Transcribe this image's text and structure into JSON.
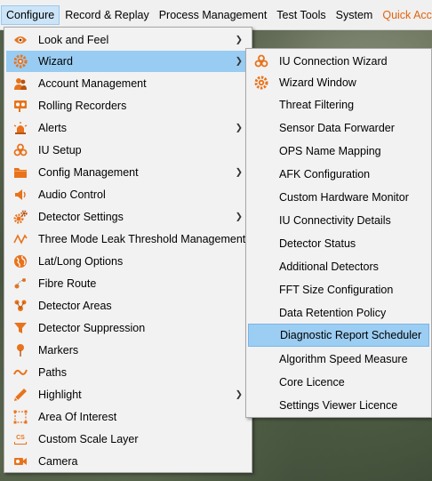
{
  "menubar": {
    "items": [
      "Configure",
      "Record & Replay",
      "Process Management",
      "Test Tools",
      "System",
      "Quick Access"
    ]
  },
  "configure_menu": {
    "items": [
      {
        "label": "Look and Feel",
        "icon": "eye-icon",
        "submenu": true
      },
      {
        "label": "Wizard",
        "icon": "gear-wizard-icon",
        "submenu": true
      },
      {
        "label": "Account Management",
        "icon": "users-icon",
        "submenu": false
      },
      {
        "label": "Rolling Recorders",
        "icon": "recorder-icon",
        "submenu": false
      },
      {
        "label": "Alerts",
        "icon": "siren-icon",
        "submenu": true
      },
      {
        "label": "IU Setup",
        "icon": "biohazard-icon",
        "submenu": false
      },
      {
        "label": "Config Management",
        "icon": "folder-icon",
        "submenu": true
      },
      {
        "label": "Audio Control",
        "icon": "speaker-icon",
        "submenu": false
      },
      {
        "label": "Detector Settings",
        "icon": "gears-icon",
        "submenu": true
      },
      {
        "label": "Three Mode Leak Threshold Management",
        "icon": "wave-icon",
        "submenu": false
      },
      {
        "label": "Lat/Long Options",
        "icon": "globe-icon",
        "submenu": false
      },
      {
        "label": "Fibre Route",
        "icon": "route-icon",
        "submenu": false
      },
      {
        "label": "Detector Areas",
        "icon": "group-icon",
        "submenu": false
      },
      {
        "label": "Detector Suppression",
        "icon": "filter-icon",
        "submenu": false
      },
      {
        "label": "Markers",
        "icon": "pin-icon",
        "submenu": false
      },
      {
        "label": "Paths",
        "icon": "path-icon",
        "submenu": false
      },
      {
        "label": "Highlight",
        "icon": "pencil-icon",
        "submenu": true
      },
      {
        "label": "Area Of Interest",
        "icon": "selection-icon",
        "submenu": false
      },
      {
        "label": "Custom Scale Layer",
        "icon": "scale-icon",
        "submenu": false
      },
      {
        "label": "Camera",
        "icon": "camera-icon",
        "submenu": false
      }
    ],
    "scale_icon_text": "CS"
  },
  "wizard_menu": {
    "items": [
      {
        "label": "IU Connection Wizard",
        "icon": "biohazard-icon"
      },
      {
        "label": "Wizard Window",
        "icon": "gear-wizard-icon"
      },
      {
        "label": "Threat Filtering",
        "icon": ""
      },
      {
        "label": "Sensor Data Forwarder",
        "icon": ""
      },
      {
        "label": "OPS Name Mapping",
        "icon": ""
      },
      {
        "label": "AFK Configuration",
        "icon": ""
      },
      {
        "label": "Custom Hardware Monitor",
        "icon": ""
      },
      {
        "label": "IU Connectivity Details",
        "icon": ""
      },
      {
        "label": "Detector Status",
        "icon": ""
      },
      {
        "label": "Additional Detectors",
        "icon": ""
      },
      {
        "label": "FFT Size Configuration",
        "icon": ""
      },
      {
        "label": "Data Retention Policy",
        "icon": ""
      },
      {
        "label": "Diagnostic Report Scheduler",
        "icon": ""
      },
      {
        "label": "Algorithm Speed Measure",
        "icon": ""
      },
      {
        "label": "Core Licence",
        "icon": ""
      },
      {
        "label": "Settings Viewer Licence",
        "icon": ""
      }
    ]
  },
  "colors": {
    "icon_orange": "#e8731c",
    "highlight": "#99ccf2",
    "quick_access": "#e0650f"
  }
}
